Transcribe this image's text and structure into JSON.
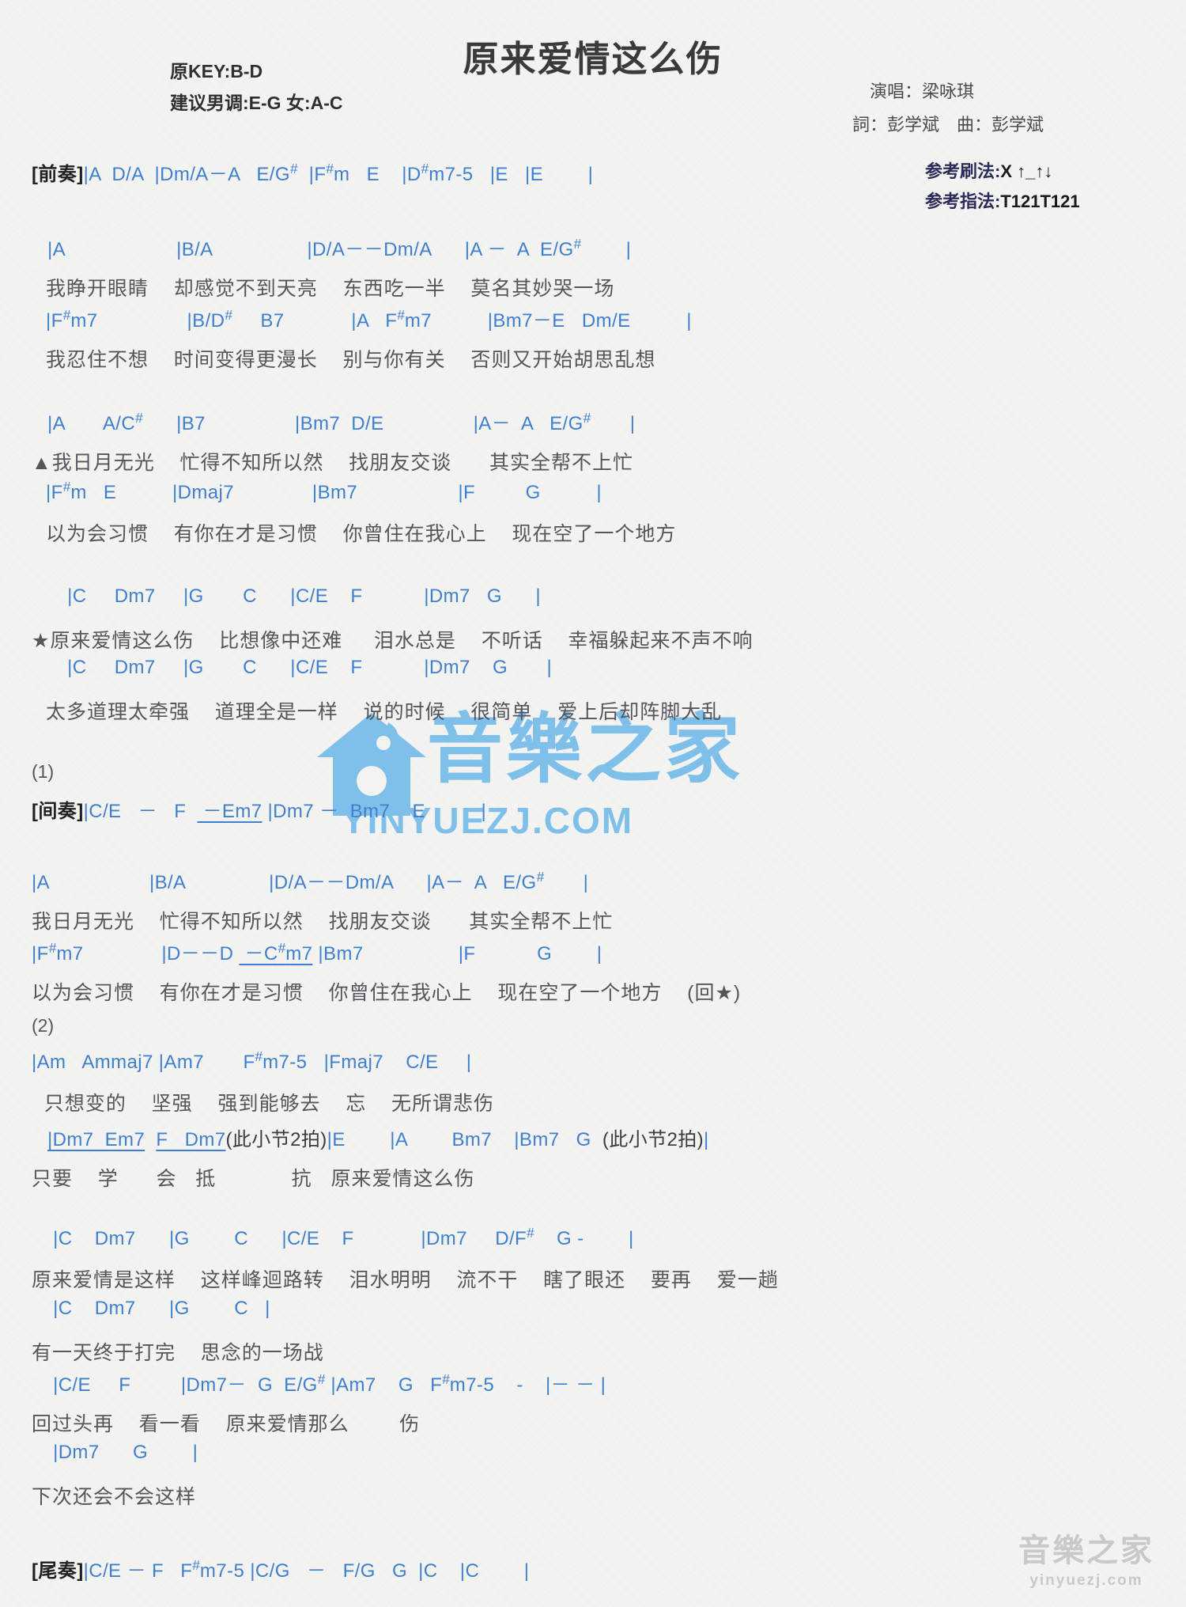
{
  "header": {
    "title": "原来爱情这么伤",
    "original_key": "原KEY:B-D",
    "suggested_key": "建议男调:E-G 女:A-C",
    "singer": "演唱：梁咏琪",
    "writer": "詞：彭学斌　曲：彭学斌",
    "strum_label": "参考刷法:",
    "strum_value": "X ↑_↑↓",
    "fingering_label": "参考指法:",
    "fingering_value": "T121T121"
  },
  "sections": {
    "intro_tag": "[前奏]",
    "interlude_tag": "[间奏]",
    "outro_tag": "[尾奏]",
    "mark_1": "(1)",
    "mark_2": "(2)"
  },
  "lines": {
    "intro_chords": "|A  D/A  |Dm/A－A   E/G#  |F#m   E    |D#m7-5   |E   |E        |",
    "v1a_chords": "|A                  |B/A               |D/A－－Dm/A      |A －  A  E/G#      |",
    "v1a_lyrics": "我睁开眼睛    却感觉不到天亮    东西吃一半    莫名其妙哭一场",
    "v1b_chords": "|F#m7                |B/D#    B7             |A   F#m7          |Bm7－E   Dm/E        |",
    "v1b_lyrics": "我忍住不想    时间变得更漫长    别与你有关    否则又开始胡思乱想",
    "v2a_chords": "|A       A/C#     |B7              |Bm7  D/E               |A－  A   E/G#      |",
    "v2a_lyrics": "▲我日月无光    忙得不知所以然    找朋友交谈      其实全帮不上忙",
    "v2b_chords": "|F#m   E        |Dmaj7            |Bm7                 |F        G         |",
    "v2b_lyrics": "以为会习惯    有你在才是习惯    你曾住在我心上    现在空了一个地方",
    "ch1_chords": " |C     Dm7     |G       C      |C/E    F           |Dm7   G      |",
    "ch1_lyrics": "★原来爱情这么伤    比想像中还难     泪水总是    不听话    幸福躲起来不声不响",
    "ch2_chords": " |C     Dm7     |G       C      |C/E    F           |Dm7    G       |",
    "ch2_lyrics": "太多道理太牵强    道理全是一样    说的时候    很简单    爱上后却阵脚大乱",
    "interlude_chords": "|C/E   －   F   －Em7 |Dm7 －  Bm7    E          |",
    "v3a_chords": "|A                |B/A             |D/A－－Dm/A       |A－  A   E/G#      |",
    "v3a_lyrics": "我日月无光    忙得不知所以然    找朋友交谈      其实全帮不上忙",
    "v3b_chords": "|F#m7            |D－－D  －C#m7 |Bm7                |F          G        |",
    "v3b_lyrics": "以为会习惯    有你在才是习惯    你曾住在我心上    现在空了一个地方    (回★)",
    "b2a_chords": "|Am   Ammaj7 |Am7      F#m7-5   |Fmaj7    C/E     |",
    "b2a_lyrics": "  只想变的    坚强    强到能够去    忘    无所谓悲伤",
    "b2b_chords": " |Dm7  Em7   F   Dm7",
    "b2b_note1": "(此小节2拍)",
    "b2b_chords2": " |E        |A        Bm7    |Bm7   G  ",
    "b2b_note2": "(此小节2拍)",
    "b2b_end": "|",
    "b2b_lyrics": "只要    学      会   抵            抗   原来爱情这么伤",
    "ch3_chords": " |C    Dm7      |G        C       |C/E    F            |Dm7     D/F#    G -        |",
    "ch3_lyrics": "原来爱情是这样    这样峰迴路转    泪水明明    流不干    瞎了眼还    要再    爱一趟",
    "ch4_chords": " |C    Dm7      |G        C   |",
    "ch4_lyrics": "有一天终于打完    思念的一场战",
    "ch5_chords": "  |C/E     F         |Dm7－  G  E/G# |Am7    G   F#m7-5    -    |－ － |",
    "ch5_lyrics": "回过头再    看一看    原来爱情那么        伤",
    "ch6_chords": " |Dm7      G        |",
    "ch6_lyrics": "下次还会不会这样",
    "outro_chords": "|C/E － F   F#m7-5 |C/G   －   F/G   G  |C    |C        |"
  },
  "watermark": {
    "center_main": "音樂之家",
    "center_sub": "YINYUEZJ.COM",
    "foot_main": "音樂之家",
    "foot_sub": "yinyuezj.com"
  },
  "colors": {
    "chord": "#3f7fd0",
    "lyric": "#55555c",
    "title": "#3a3a3a",
    "watermark": "#7fc0ea",
    "paper": "#f3f3f1"
  }
}
